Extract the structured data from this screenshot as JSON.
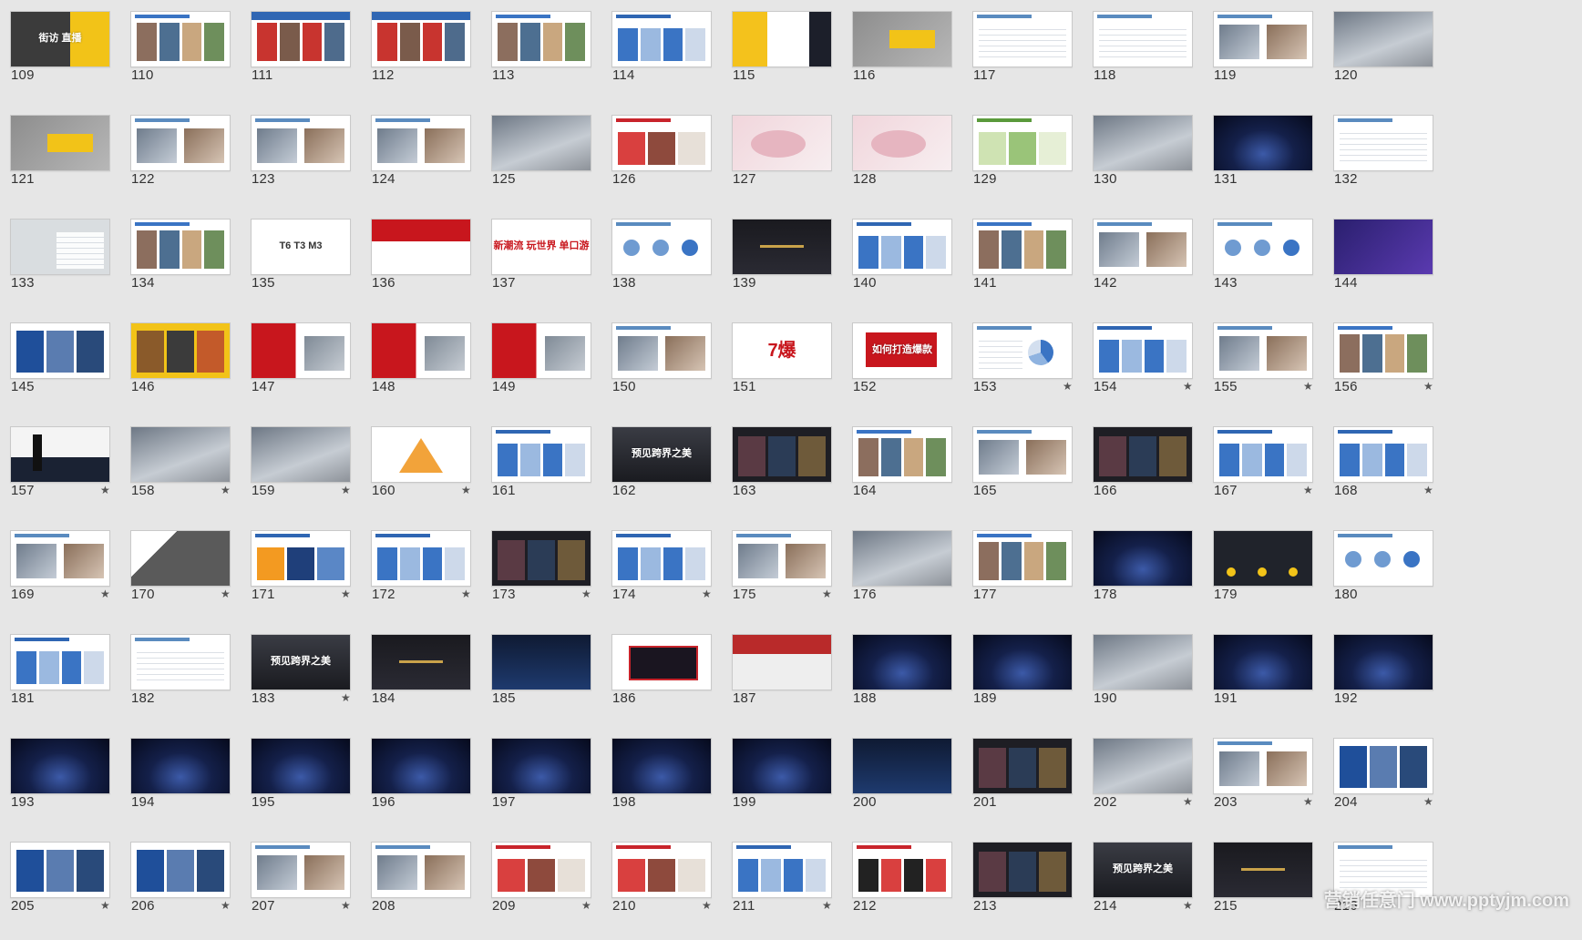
{
  "slides": [
    {
      "n": "109",
      "star": false,
      "style": "yellow",
      "text": "街访 直播"
    },
    {
      "n": "110",
      "star": false,
      "style": "collage"
    },
    {
      "n": "111",
      "star": false,
      "style": "collage-red"
    },
    {
      "n": "112",
      "star": false,
      "style": "collage-red"
    },
    {
      "n": "113",
      "star": false,
      "style": "collage"
    },
    {
      "n": "114",
      "star": false,
      "style": "doc-blue"
    },
    {
      "n": "115",
      "star": false,
      "style": "yellow-dark"
    },
    {
      "n": "116",
      "star": false,
      "style": "grey-photo"
    },
    {
      "n": "117",
      "star": false,
      "style": "doc"
    },
    {
      "n": "118",
      "star": false,
      "style": "doc"
    },
    {
      "n": "119",
      "star": false,
      "style": "doc-photo"
    },
    {
      "n": "120",
      "star": false,
      "style": "photo-grey"
    },
    {
      "n": "121",
      "star": false,
      "style": "grey-yellow"
    },
    {
      "n": "122",
      "star": false,
      "style": "doc-photo"
    },
    {
      "n": "123",
      "star": false,
      "style": "doc-photo"
    },
    {
      "n": "124",
      "star": false,
      "style": "doc-photo"
    },
    {
      "n": "125",
      "star": false,
      "style": "photo-grey"
    },
    {
      "n": "126",
      "star": false,
      "style": "doc-red"
    },
    {
      "n": "127",
      "star": false,
      "style": "pink"
    },
    {
      "n": "128",
      "star": false,
      "style": "pink"
    },
    {
      "n": "129",
      "star": false,
      "style": "doc-green"
    },
    {
      "n": "130",
      "star": false,
      "style": "photo-grey"
    },
    {
      "n": "131",
      "star": false,
      "style": "night"
    },
    {
      "n": "132",
      "star": false,
      "style": "doc"
    },
    {
      "n": "133",
      "star": false,
      "style": "grey-doc"
    },
    {
      "n": "134",
      "star": false,
      "style": "collage"
    },
    {
      "n": "135",
      "star": false,
      "style": "white-text",
      "text": "T6 T3 M3"
    },
    {
      "n": "136",
      "star": false,
      "style": "red-cars"
    },
    {
      "n": "137",
      "star": false,
      "style": "white-text-red",
      "text": "新潮流 玩世界 单口游"
    },
    {
      "n": "138",
      "star": false,
      "style": "doc-circles"
    },
    {
      "n": "139",
      "star": false,
      "style": "dark"
    },
    {
      "n": "140",
      "star": false,
      "style": "doc-blue"
    },
    {
      "n": "141",
      "star": false,
      "style": "collage"
    },
    {
      "n": "142",
      "star": false,
      "style": "doc-photo"
    },
    {
      "n": "143",
      "star": false,
      "style": "doc-circles"
    },
    {
      "n": "144",
      "star": false,
      "style": "purple"
    },
    {
      "n": "145",
      "star": false,
      "style": "collage-blue"
    },
    {
      "n": "146",
      "star": false,
      "style": "yellow-collage"
    },
    {
      "n": "147",
      "star": false,
      "style": "red-half"
    },
    {
      "n": "148",
      "star": false,
      "style": "red-half"
    },
    {
      "n": "149",
      "star": false,
      "style": "red-half"
    },
    {
      "n": "150",
      "star": false,
      "style": "doc-photo"
    },
    {
      "n": "151",
      "star": false,
      "style": "white-text-red",
      "text": "7爆"
    },
    {
      "n": "152",
      "star": false,
      "style": "red-box",
      "text": "如何打造爆款"
    },
    {
      "n": "153",
      "star": true,
      "style": "doc-chart"
    },
    {
      "n": "154",
      "star": true,
      "style": "doc-blue"
    },
    {
      "n": "155",
      "star": true,
      "style": "doc-photo"
    },
    {
      "n": "156",
      "star": true,
      "style": "collage"
    },
    {
      "n": "157",
      "star": true,
      "style": "dark-person"
    },
    {
      "n": "158",
      "star": true,
      "style": "photo-grey"
    },
    {
      "n": "159",
      "star": true,
      "style": "photo-grey"
    },
    {
      "n": "160",
      "star": true,
      "style": "pyramid"
    },
    {
      "n": "161",
      "star": false,
      "style": "doc-blue"
    },
    {
      "n": "162",
      "star": false,
      "style": "dark-city",
      "text": "预见跨界之美"
    },
    {
      "n": "163",
      "star": false,
      "style": "collage-dark"
    },
    {
      "n": "164",
      "star": false,
      "style": "collage"
    },
    {
      "n": "165",
      "star": false,
      "style": "doc-photo"
    },
    {
      "n": "166",
      "star": false,
      "style": "collage-dark"
    },
    {
      "n": "167",
      "star": true,
      "style": "doc-blue"
    },
    {
      "n": "168",
      "star": true,
      "style": "doc-blue"
    },
    {
      "n": "169",
      "star": true,
      "style": "doc-photo"
    },
    {
      "n": "170",
      "star": true,
      "style": "grey-dark"
    },
    {
      "n": "171",
      "star": true,
      "style": "doc-orange"
    },
    {
      "n": "172",
      "star": true,
      "style": "doc-blue"
    },
    {
      "n": "173",
      "star": true,
      "style": "collage-dark"
    },
    {
      "n": "174",
      "star": true,
      "style": "doc-blue"
    },
    {
      "n": "175",
      "star": true,
      "style": "doc-photo"
    },
    {
      "n": "176",
      "star": false,
      "style": "photo-grey"
    },
    {
      "n": "177",
      "star": false,
      "style": "collage"
    },
    {
      "n": "178",
      "star": false,
      "style": "night"
    },
    {
      "n": "179",
      "star": false,
      "style": "dark-gold"
    },
    {
      "n": "180",
      "star": false,
      "style": "doc-circles"
    },
    {
      "n": "181",
      "star": false,
      "style": "doc-blue"
    },
    {
      "n": "182",
      "star": false,
      "style": "doc"
    },
    {
      "n": "183",
      "star": true,
      "style": "dark-city",
      "text": "预见跨界之美"
    },
    {
      "n": "184",
      "star": false,
      "style": "dark"
    },
    {
      "n": "185",
      "star": false,
      "style": "dark-blue"
    },
    {
      "n": "186",
      "star": false,
      "style": "dark-red"
    },
    {
      "n": "187",
      "star": false,
      "style": "stage"
    },
    {
      "n": "188",
      "star": false,
      "style": "night"
    },
    {
      "n": "189",
      "star": false,
      "style": "night"
    },
    {
      "n": "190",
      "star": false,
      "style": "photo-grey"
    },
    {
      "n": "191",
      "star": false,
      "style": "night"
    },
    {
      "n": "192",
      "star": false,
      "style": "night"
    },
    {
      "n": "193",
      "star": false,
      "style": "night"
    },
    {
      "n": "194",
      "star": false,
      "style": "night"
    },
    {
      "n": "195",
      "star": false,
      "style": "night"
    },
    {
      "n": "196",
      "star": false,
      "style": "night"
    },
    {
      "n": "197",
      "star": false,
      "style": "night"
    },
    {
      "n": "198",
      "star": false,
      "style": "night"
    },
    {
      "n": "199",
      "star": false,
      "style": "night"
    },
    {
      "n": "200",
      "star": false,
      "style": "dark-blue"
    },
    {
      "n": "201",
      "star": false,
      "style": "collage-dark"
    },
    {
      "n": "202",
      "star": true,
      "style": "photo-grey"
    },
    {
      "n": "203",
      "star": true,
      "style": "doc-photo"
    },
    {
      "n": "204",
      "star": true,
      "style": "collage-blue"
    },
    {
      "n": "205",
      "star": true,
      "style": "collage-blue"
    },
    {
      "n": "206",
      "star": true,
      "style": "collage-blue"
    },
    {
      "n": "207",
      "star": true,
      "style": "doc-photo"
    },
    {
      "n": "208",
      "star": false,
      "style": "doc-photo"
    },
    {
      "n": "209",
      "star": true,
      "style": "doc-red"
    },
    {
      "n": "210",
      "star": true,
      "style": "doc-red"
    },
    {
      "n": "211",
      "star": true,
      "style": "doc-blue"
    },
    {
      "n": "212",
      "star": false,
      "style": "doc-phones"
    },
    {
      "n": "213",
      "star": false,
      "style": "collage-dark"
    },
    {
      "n": "214",
      "star": true,
      "style": "dark-city",
      "text": "预见跨界之美"
    },
    {
      "n": "215",
      "star": false,
      "style": "dark"
    },
    {
      "n": "216",
      "star": false,
      "style": "doc"
    }
  ],
  "star_symbol": "★",
  "watermark": "营销任意门 www.pptyjm.com"
}
